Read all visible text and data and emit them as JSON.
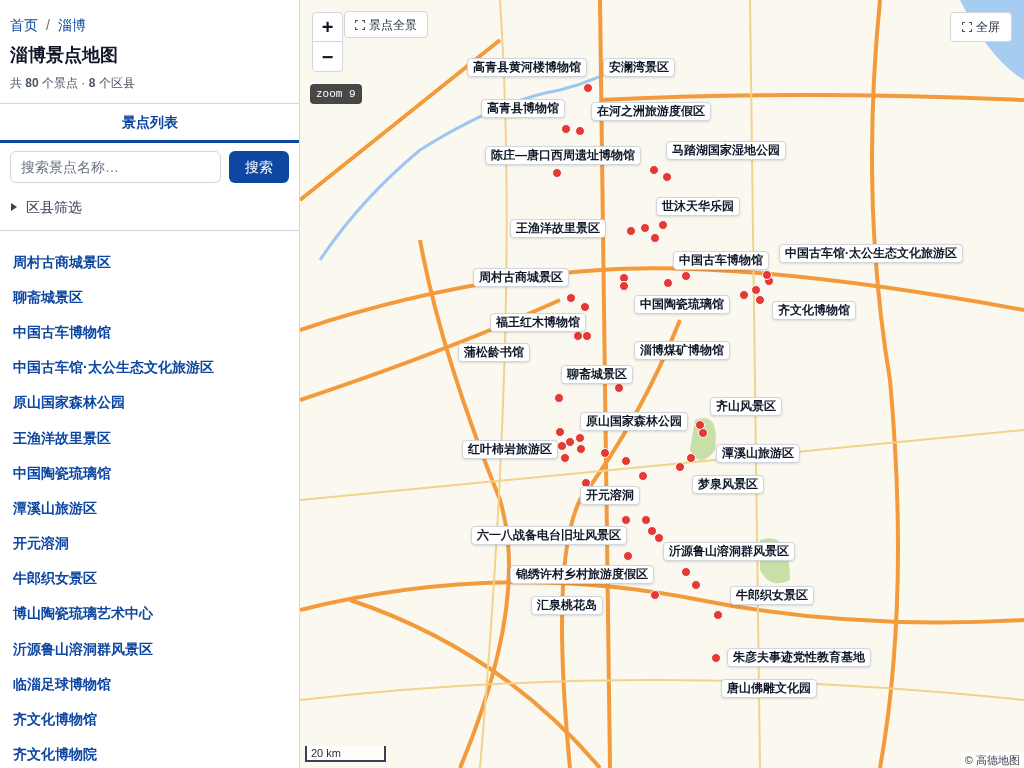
{
  "breadcrumb": [
    {
      "label": "首页"
    },
    {
      "label": "淄博"
    }
  ],
  "breadcrumb_separator": "/",
  "title": "淄博景点地图",
  "stats": "共 **80** 个景点 · **8** 个区县",
  "tabs": [
    {
      "label": "景点列表",
      "selected": true
    }
  ],
  "search": {
    "placeholder": "搜索景点名称…",
    "button": "搜索"
  },
  "filter": {
    "label": "区县筛选",
    "expanded": false
  },
  "spots": [
    "周村古商城景区",
    "聊斋城景区",
    "中国古车博物馆",
    "中国古车馆·太公生态文化旅游区",
    "原山国家森林公园",
    "王渔洋故里景区",
    "中国陶瓷琉璃馆",
    "潭溪山旅游区",
    "开元溶洞",
    "牛郎织女景区",
    "博山陶瓷琉璃艺术中心",
    "沂源鲁山溶洞群风景区",
    "临淄足球博物馆",
    "齐文化博物馆",
    "齐文化博物院"
  ],
  "map": {
    "zoom_in": "+",
    "zoom_out": "−",
    "overview_button": "景点全景",
    "fullscreen_button": "全屏",
    "zoom_badge": "zoom 9",
    "scale": "20 km",
    "attribution": "© 高德地图",
    "labels": [
      "高青县黄河楼博物馆",
      "安澜湾景区",
      "高青县博物馆",
      "在河之洲旅游度假区",
      "陈庄—唐口西周遗址博物馆",
      "马踏湖国家湿地公园",
      "世沐天华乐园",
      "王渔洋故里景区",
      "中国古车博物馆",
      "中国古车馆·太公生态文化旅游区",
      "周村古商城景区",
      "中国陶瓷琉璃馆",
      "齐文化博物馆",
      "福王红木博物馆",
      "蒲松龄书馆",
      "淄博煤矿博物馆",
      "聊斋城景区",
      "齐山风景区",
      "原山国家森林公园",
      "红叶柿岩旅游区",
      "潭溪山旅游区",
      "梦泉风景区",
      "开元溶洞",
      "六一八战备电台旧址风景区",
      "沂源鲁山溶洞群风景区",
      "锦绣许村乡村旅游度假区",
      "汇泉桃花岛",
      "牛郎织女景区",
      "朱彦夫事迹党性教育基地",
      "唐山佛雕文化园"
    ]
  }
}
